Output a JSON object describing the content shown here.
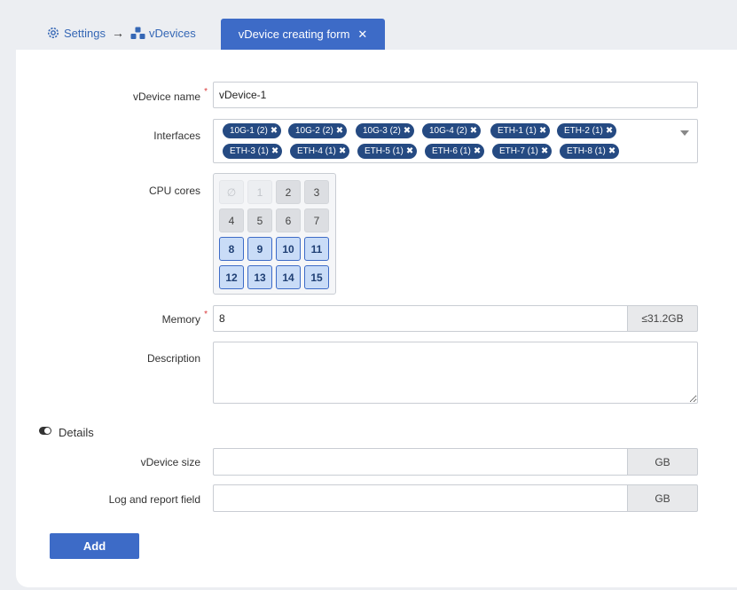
{
  "breadcrumb": {
    "settings_label": "Settings",
    "vdevices_label": "vDevices"
  },
  "tab": {
    "title": "vDevice creating form",
    "close_glyph": "✕"
  },
  "form": {
    "name": {
      "label": "vDevice name",
      "required": "*",
      "value": "vDevice-1"
    },
    "interfaces": {
      "label": "Interfaces",
      "chips": [
        "10G-1 (2)",
        "10G-2 (2)",
        "10G-3 (2)",
        "10G-4 (2)",
        "ETH-1 (1)",
        "ETH-2 (1)",
        "ETH-3 (1)",
        "ETH-4 (1)",
        "ETH-5 (1)",
        "ETH-6 (1)",
        "ETH-7 (1)",
        "ETH-8 (1)"
      ],
      "chip_remove_glyph": "✖"
    },
    "cpu": {
      "label": "CPU cores",
      "cores": [
        {
          "n": "0",
          "state": "disabled"
        },
        {
          "n": "1",
          "state": "disabled"
        },
        {
          "n": "2",
          "state": "normal"
        },
        {
          "n": "3",
          "state": "normal"
        },
        {
          "n": "4",
          "state": "normal"
        },
        {
          "n": "5",
          "state": "normal"
        },
        {
          "n": "6",
          "state": "normal"
        },
        {
          "n": "7",
          "state": "normal"
        },
        {
          "n": "8",
          "state": "selected"
        },
        {
          "n": "9",
          "state": "selected"
        },
        {
          "n": "10",
          "state": "selected"
        },
        {
          "n": "11",
          "state": "selected"
        },
        {
          "n": "12",
          "state": "selected"
        },
        {
          "n": "13",
          "state": "selected"
        },
        {
          "n": "14",
          "state": "selected"
        },
        {
          "n": "15",
          "state": "selected"
        }
      ]
    },
    "memory": {
      "label": "Memory",
      "required": "*",
      "value": "8",
      "addon": "≤31.2GB"
    },
    "description": {
      "label": "Description",
      "value": ""
    },
    "details": {
      "label": "Details",
      "size": {
        "label": "vDevice size",
        "value": "",
        "addon": "GB"
      },
      "log": {
        "label": "Log and report field",
        "value": "",
        "addon": "GB"
      }
    },
    "add_label": "Add"
  },
  "colors": {
    "accent": "#3d6bc7",
    "chip": "#254a82",
    "required": "#d9383a"
  }
}
